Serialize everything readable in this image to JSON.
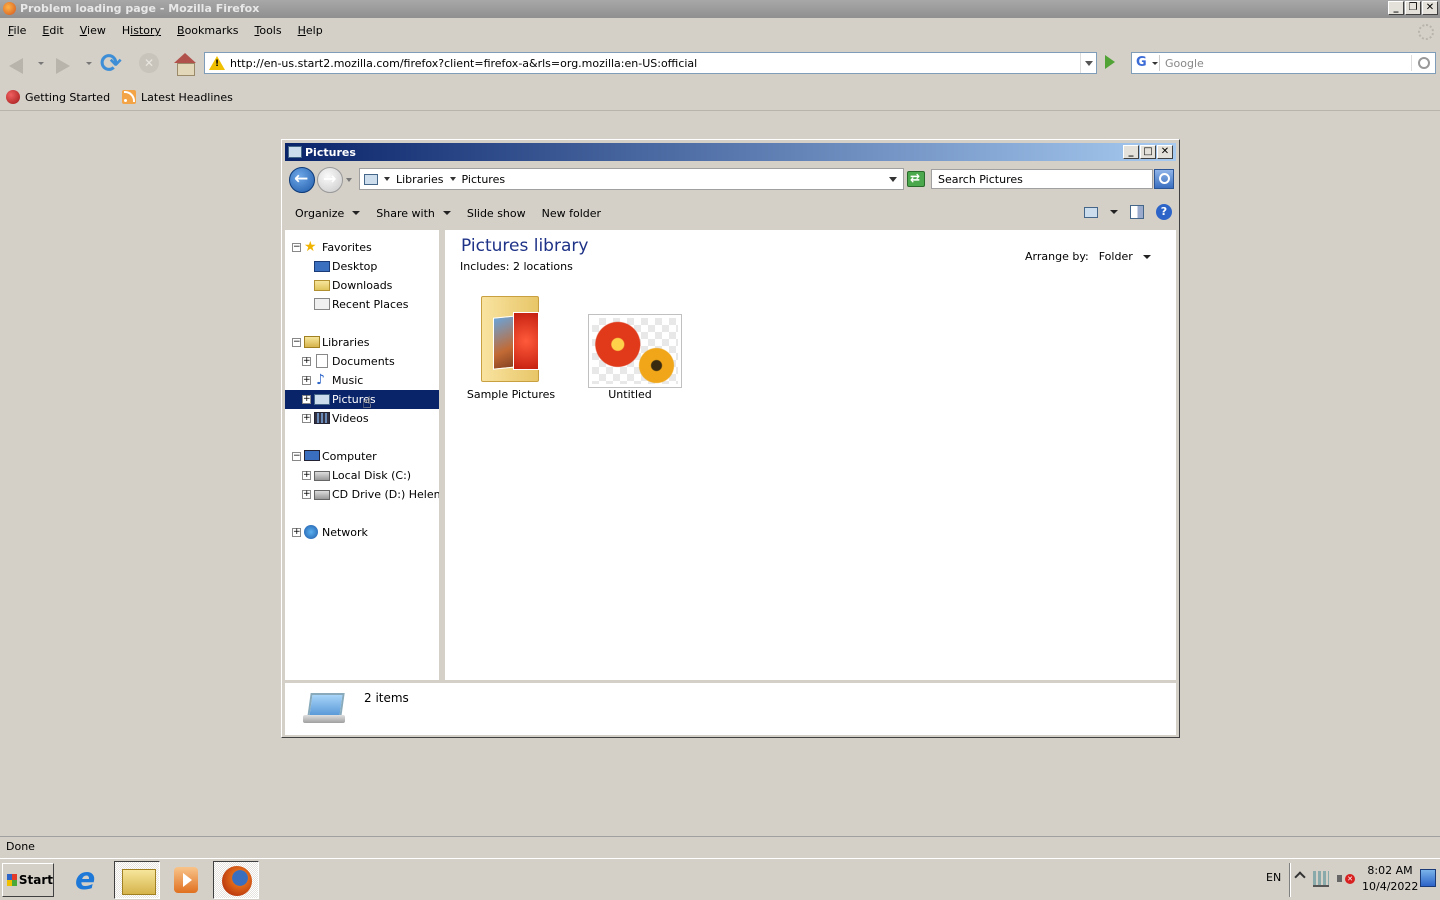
{
  "browser": {
    "title": "Problem loading page - Mozilla Firefox",
    "menu": [
      {
        "label": "File",
        "key": "F",
        "rest": "ile"
      },
      {
        "label": "Edit",
        "key": "E",
        "rest": "dit"
      },
      {
        "label": "View",
        "key": "V",
        "rest": "iew"
      },
      {
        "label": "History",
        "key": "H",
        "rest": "istory"
      },
      {
        "label": "Bookmarks",
        "key": "B",
        "rest": "ookmarks"
      },
      {
        "label": "Tools",
        "key": "T",
        "rest": "ools"
      },
      {
        "label": "Help",
        "key": "H",
        "rest": "elp"
      }
    ],
    "url": "http://en-us.start2.mozilla.com/firefox?client=firefox-a&rls=org.mozilla:en-US:official",
    "search_placeholder": "Google",
    "bookmarks": [
      {
        "label": "Getting Started",
        "icon": "firefox-icon"
      },
      {
        "label": "Latest Headlines",
        "icon": "rss-icon"
      }
    ],
    "status": "Done"
  },
  "explorer": {
    "title": "Pictures",
    "breadcrumb": [
      "Libraries",
      "Pictures"
    ],
    "search_placeholder": "Search Pictures",
    "commands": {
      "organize": "Organize",
      "share_with": "Share with",
      "slide_show": "Slide show",
      "new_folder": "New folder"
    },
    "tree": {
      "favorites": "Favorites",
      "desktop": "Desktop",
      "downloads": "Downloads",
      "recent_places": "Recent Places",
      "libraries": "Libraries",
      "documents": "Documents",
      "music": "Music",
      "pictures": "Pictures",
      "videos": "Videos",
      "computer": "Computer",
      "local_disk": "Local Disk (C:)",
      "cd_drive": "CD Drive (D:) HelenOS",
      "network": "Network"
    },
    "content": {
      "heading": "Pictures library",
      "includes_label": "Includes:",
      "includes_value": "2 locations",
      "arrange_label": "Arrange by:",
      "arrange_value": "Folder",
      "items": [
        {
          "name": "Sample Pictures",
          "type": "folder"
        },
        {
          "name": "Untitled",
          "type": "image"
        }
      ]
    },
    "details": {
      "count": "2 items"
    }
  },
  "taskbar": {
    "start": "Start",
    "language": "EN",
    "time": "8:02 AM",
    "date": "10/4/2022"
  }
}
